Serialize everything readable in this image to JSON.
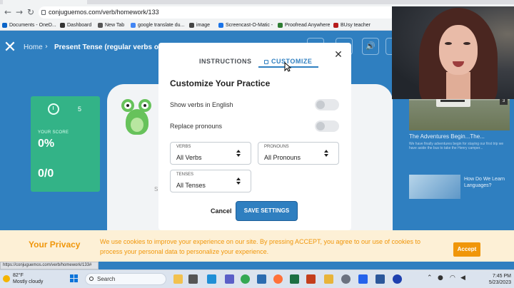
{
  "browser": {
    "tab_title": "Present Tense (regular verbs on...",
    "url": "conjuguemos.com/verb/homework/133",
    "back_glyph": "←",
    "forward_glyph": "→",
    "reload_glyph": "↻",
    "bookmarks": [
      {
        "label": "Documents - OneD...",
        "icon": "onedrive-icon",
        "color": "#0a64c8"
      },
      {
        "label": "Dashboard",
        "icon": "dashboard-icon",
        "color": "#333333"
      },
      {
        "label": "New Tab",
        "icon": "new-tab-icon",
        "color": "#555555"
      },
      {
        "label": "google translate du...",
        "icon": "google-icon",
        "color": "#4285f4"
      },
      {
        "label": "image",
        "icon": "image-icon",
        "color": "#444444"
      },
      {
        "label": "Screencast-O-Matic -",
        "icon": "screencast-icon",
        "color": "#1a73e8"
      },
      {
        "label": "Proofread Anywhere",
        "icon": "proofread-icon",
        "color": "#2e7d32"
      },
      {
        "label": "BUsy teacher",
        "icon": "busy-teacher-icon",
        "color": "#b71c1c"
      }
    ]
  },
  "page": {
    "close_glyph": "✕",
    "breadcrumb": {
      "home": "Home",
      "separator": "›",
      "current": "Present Tense (regular verbs on"
    },
    "top_icons": [
      {
        "name": "sound-icon",
        "glyph": "🔊"
      }
    ],
    "score": {
      "timer_count": "5",
      "label": "YOUR SCORE",
      "percent": "0%",
      "fraction": "0/0"
    },
    "practice_letter": "S"
  },
  "modal": {
    "tabs": {
      "instructions": "INSTRUCTIONS",
      "customize": "CUSTOMIZE"
    },
    "close_glyph": "✕",
    "title": "Customize Your Practice",
    "options": [
      {
        "label": "Show verbs in English",
        "enabled": false
      },
      {
        "label": "Replace pronouns",
        "enabled": false
      }
    ],
    "selects": {
      "verbs": {
        "caption": "VERBS",
        "value": "All Verbs"
      },
      "pronouns": {
        "caption": "PRONOUNS",
        "value": "All Pronouns"
      },
      "tenses": {
        "caption": "TENSES",
        "value": "All Tenses"
      }
    },
    "cancel_label": "Cancel",
    "save_label": "SAVE SETTINGS"
  },
  "sidebar": {
    "video_badge": "3",
    "video_title": "The Adventures Begin...The...",
    "video_desc": "We have finally adventures begin for staying our first trip we have aside the bus to take the Henry camper...",
    "article_title": "How Do We Learn Languages?"
  },
  "cookie": {
    "title": "Your Privacy",
    "text": "We use cookies to improve your experience on our site. By pressing ACCEPT, you agree to our use of cookies to process your personal data to personalize your experience.",
    "accept_label": "Accept"
  },
  "status_url": "https://conjuguemos.com/verb/homework/133#",
  "taskbar": {
    "weather_temp": "82°F",
    "weather_desc": "Mostly cloudy",
    "search_label": "Search",
    "time": "7:45 PM",
    "date": "5/23/2023",
    "apps": [
      {
        "name": "file-explorer-icon",
        "color": "#f2c14e"
      },
      {
        "name": "task-view-icon",
        "color": "#555555"
      },
      {
        "name": "teams-icon",
        "color": "#5b5fc7"
      },
      {
        "name": "edge-icon",
        "color": "#1f8fd6"
      },
      {
        "name": "chrome-icon",
        "color": "#34a853"
      },
      {
        "name": "store-icon",
        "color": "#2b6cb0"
      },
      {
        "name": "firefox-icon",
        "color": "#ff7139"
      },
      {
        "name": "excel-icon",
        "color": "#1d6f42"
      },
      {
        "name": "powerpoint-icon",
        "color": "#c43e1c"
      },
      {
        "name": "folder-icon",
        "color": "#e8b43a"
      },
      {
        "name": "settings-icon",
        "color": "#6b7280"
      },
      {
        "name": "snipping-icon",
        "color": "#2563eb"
      },
      {
        "name": "word-icon",
        "color": "#2b579a"
      },
      {
        "name": "camera-icon",
        "color": "#1e40af"
      }
    ]
  },
  "colors": {
    "brand_blue": "#2f7fc0",
    "score_green": "#33b387",
    "cookie_orange": "#f0960a"
  }
}
